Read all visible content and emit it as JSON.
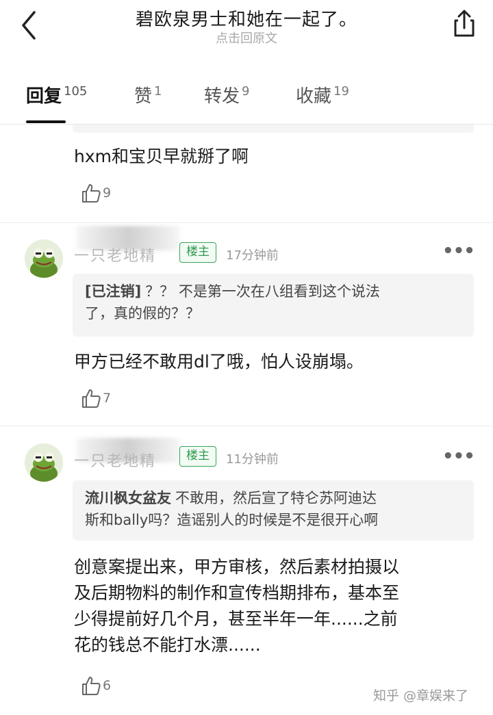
{
  "header": {
    "title": "碧欧泉男士和她在一起了。",
    "subtitle": "点击回原文",
    "back_icon": "chevron-left-icon",
    "share_icon": "share-icon"
  },
  "tabs": [
    {
      "label": "回复",
      "count": "105",
      "active": true
    },
    {
      "label": "赞",
      "count": "1",
      "active": false
    },
    {
      "label": "转发",
      "count": "9",
      "active": false
    },
    {
      "label": "收藏",
      "count": "19",
      "active": false
    }
  ],
  "comments": [
    {
      "text": "hxm和宝贝早就掰了啊",
      "likes": "9"
    },
    {
      "username": "一只老地精",
      "badge": "楼主",
      "time": "17分钟前",
      "quote_name": "[已注销]",
      "quote_line1": "？？ 不是第一次在八组看到这个说法",
      "quote_line2": "了，真的假的？？",
      "text": "甲方已经不敢用dl了哦，怕人设崩塌。",
      "likes": "7"
    },
    {
      "username": "一只老地精",
      "badge": "楼主",
      "time": "11分钟前",
      "quote_name": "流川枫女盆友",
      "quote_line1": "不敢用，然后宣了特仑苏阿迪达",
      "quote_line2": "斯和bally吗？造谣别人的时候是不是很开心啊",
      "text_lines": [
        "创意案提出来，甲方审核，然后素材拍摄以",
        "及后期物料的制作和宣传档期排布，基本至",
        "少得提前好几个月，甚至半年一年......之前",
        "花的钱总不能打水漂......"
      ],
      "likes": "6"
    }
  ],
  "watermark": "知乎 @章娱来了",
  "colors": {
    "badge_green": "#3aa35a",
    "quote_bg": "#f4f4f4",
    "muted": "#999999"
  }
}
